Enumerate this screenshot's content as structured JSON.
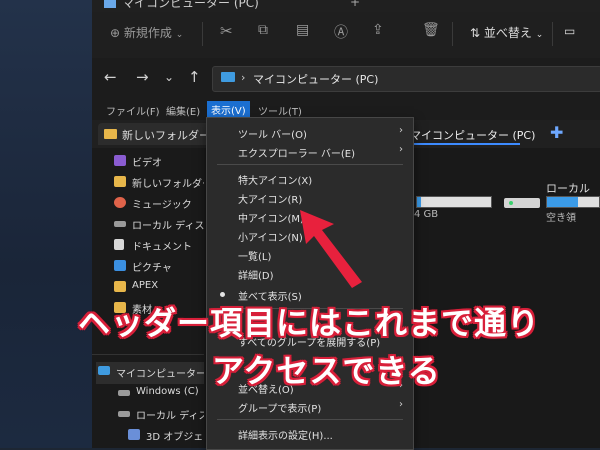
{
  "window": {
    "title": "マイコンピューター (PC)"
  },
  "toolbar": {
    "new_label": "新規作成",
    "sort_label": "並べ替え"
  },
  "address": {
    "path": "マイコンピューター (PC)",
    "chevron": "›"
  },
  "menubar": [
    {
      "label": "ファイル(F)"
    },
    {
      "label": "編集(E)"
    },
    {
      "label": "表示(V)"
    },
    {
      "label": "ツール(T)"
    }
  ],
  "tabs": [
    {
      "label": "新しいフォルダー ("
    },
    {
      "label": "マイコンピューター (PC)"
    }
  ],
  "sidebar": [
    {
      "label": "ビデオ",
      "icon": "video-icon",
      "color": "#8a5cd1"
    },
    {
      "label": "新しいフォルダー (",
      "icon": "folder-icon",
      "color": "#e7b64a"
    },
    {
      "label": "ミュージック",
      "icon": "music-icon",
      "color": "#e0634a"
    },
    {
      "label": "ローカル ディスク (I",
      "icon": "drive-icon",
      "color": "#9a9a9a"
    },
    {
      "label": "ドキュメント",
      "icon": "document-icon",
      "color": "#d8d8d8"
    },
    {
      "label": "ピクチャ",
      "icon": "picture-icon",
      "color": "#3b8fe0"
    },
    {
      "label": "APEX",
      "icon": "folder-icon",
      "color": "#e7b64a"
    },
    {
      "label": "素材",
      "icon": "folder-icon",
      "color": "#e7b64a"
    },
    {
      "label": "マイコンピューター",
      "icon": "pc-icon",
      "color": "#3f9be0"
    },
    {
      "label": "Windows (C)",
      "icon": "drive-icon",
      "color": "#9a9a9a"
    },
    {
      "label": "ローカル ディスク",
      "icon": "drive-icon",
      "color": "#9a9a9a"
    },
    {
      "label": "3D オブジェクト",
      "icon": "cube-icon",
      "color": "#6a8fd8"
    }
  ],
  "content": {
    "drive1_size": "4 GB",
    "drive1_fill": 0.05,
    "drive2_label": "ローカル",
    "drive2_free": "空き領",
    "drive2_fill": 0.6
  },
  "view_menu": [
    {
      "label": "ツール バー(O)",
      "arrow": "›"
    },
    {
      "label": "エクスプローラー バー(E)",
      "arrow": "›"
    },
    {
      "label": "特大アイコン(X)"
    },
    {
      "label": "大アイコン(R)"
    },
    {
      "label": "中アイコン(M)"
    },
    {
      "label": "小アイコン(N)"
    },
    {
      "label": "一覧(L)"
    },
    {
      "label": "詳細(D)"
    },
    {
      "label": "並べて表示(S)",
      "checked": true
    },
    {
      "label": "すべてのグループを展開する(P)"
    },
    {
      "label": "並べ替え(O)",
      "arrow": "›"
    },
    {
      "label": "グループで表示(P)",
      "arrow": "›"
    },
    {
      "label": "詳細表示の設定(H)..."
    }
  ],
  "annotation": {
    "line1": "ヘッダー項目にはこれまで通り",
    "line2": "アクセスできる",
    "color": "#e8213d"
  }
}
